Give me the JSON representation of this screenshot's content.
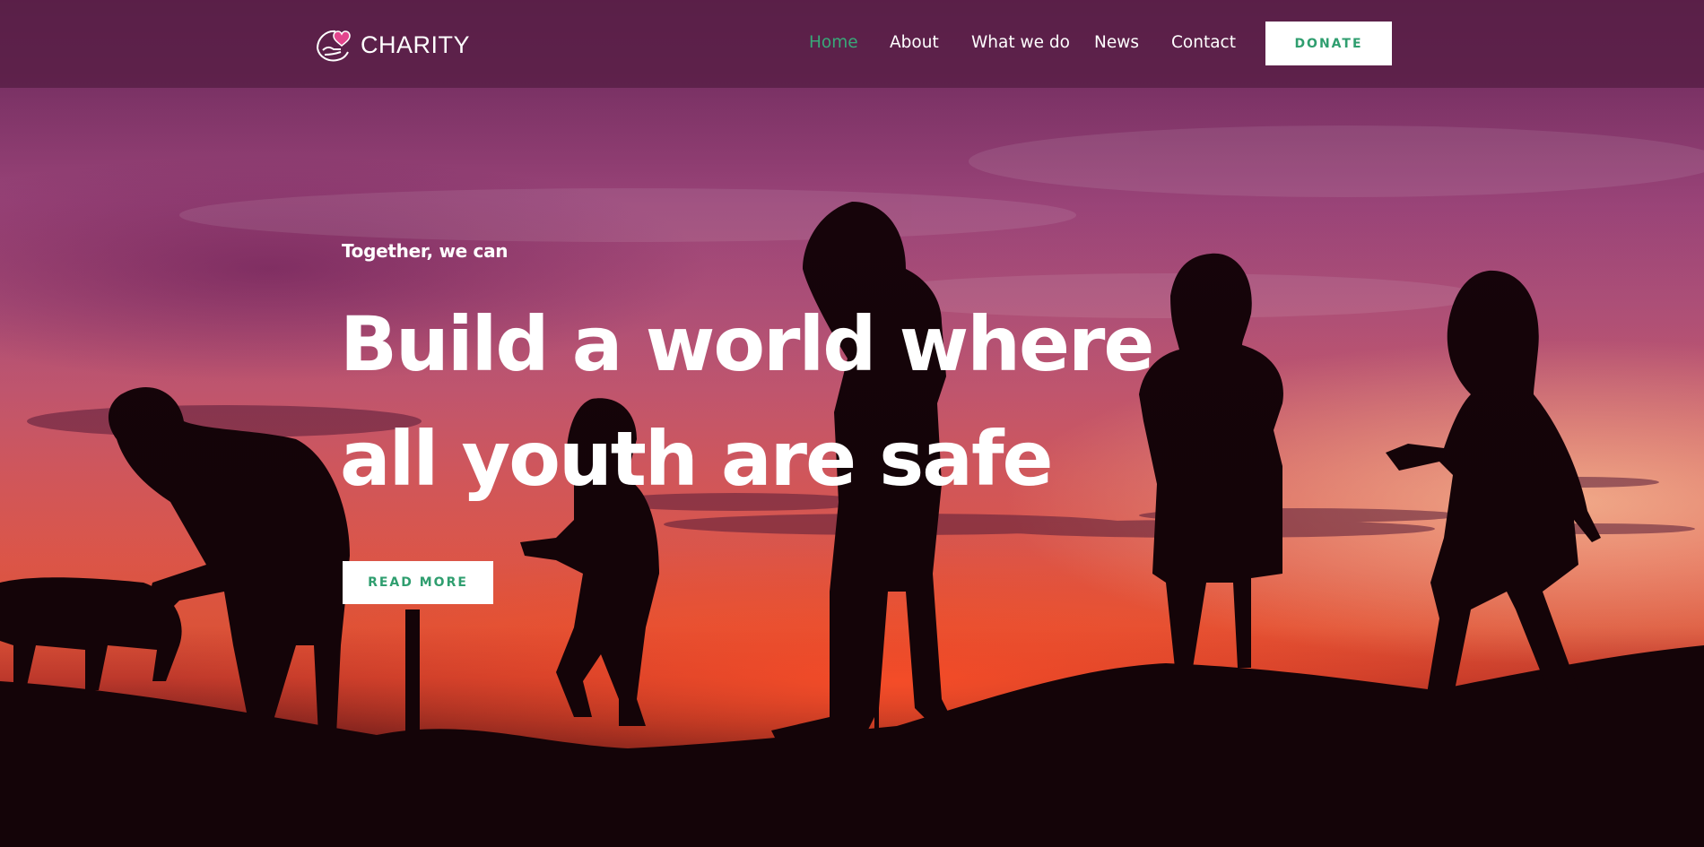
{
  "brand": {
    "name": "CHARITY",
    "logo_icon": "hand-heart-icon",
    "heart_color": "#e2458d"
  },
  "nav": {
    "items": [
      {
        "label": "Home",
        "active": true
      },
      {
        "label": "About",
        "active": false
      },
      {
        "label": "What we do",
        "active": false
      },
      {
        "label": "News",
        "active": false
      },
      {
        "label": "Contact",
        "active": false
      }
    ],
    "donate_label": "DONATE"
  },
  "hero": {
    "eyebrow": "Together, we can",
    "headline_line1": "Build a world where",
    "headline_line2": "all youth are safe",
    "cta_label": "READ MORE",
    "background": "sunset-children-silhouette"
  },
  "colors": {
    "accent": "#2f9e6f",
    "header_bg": "#581e46",
    "text": "#ffffff"
  }
}
